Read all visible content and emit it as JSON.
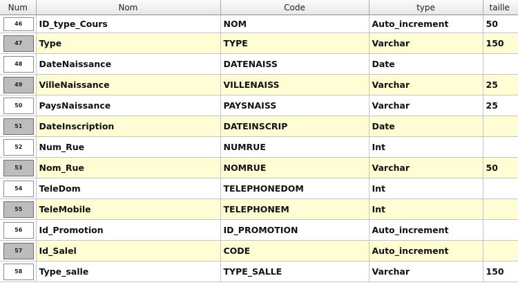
{
  "headers": {
    "num": "Num",
    "nom": "Nom",
    "code": "Code",
    "type": "type",
    "taille": "taille"
  },
  "rows": [
    {
      "num": "46",
      "nom": "ID_type_Cours",
      "code": "NOM",
      "type": "Auto_increment",
      "taille": "50"
    },
    {
      "num": "47",
      "nom": "Type",
      "code": "TYPE",
      "type": "Varchar",
      "taille": "150"
    },
    {
      "num": "48",
      "nom": "DateNaissance",
      "code": "DATENAISS",
      "type": "Date",
      "taille": ""
    },
    {
      "num": "49",
      "nom": "VilleNaissance",
      "code": "VILLENAISS",
      "type": "Varchar",
      "taille": "25"
    },
    {
      "num": "50",
      "nom": "PaysNaissance",
      "code": "PAYSNAISS",
      "type": "Varchar",
      "taille": "25"
    },
    {
      "num": "51",
      "nom": "DateInscription",
      "code": "DATEINSCRIP",
      "type": "Date",
      "taille": ""
    },
    {
      "num": "52",
      "nom": "Num_Rue",
      "code": "NUMRUE",
      "type": "Int",
      "taille": ""
    },
    {
      "num": "53",
      "nom": "Nom_Rue",
      "code": "NOMRUE",
      "type": "Varchar",
      "taille": "50"
    },
    {
      "num": "54",
      "nom": "TeleDom",
      "code": "TELEPHONEDOM",
      "type": "Int",
      "taille": ""
    },
    {
      "num": "55",
      "nom": "TeleMobile",
      "code": "TELEPHONEM",
      "type": "Int",
      "taille": ""
    },
    {
      "num": "56",
      "nom": "Id_Promotion",
      "code": "ID_PROMOTION",
      "type": "Auto_increment",
      "taille": ""
    },
    {
      "num": "57",
      "nom": "Id_Salel",
      "code": "CODE",
      "type": "Auto_increment",
      "taille": ""
    },
    {
      "num": "58",
      "nom": "Type_salle",
      "code": "TYPE_SALLE",
      "type": "Varchar",
      "taille": "150"
    }
  ],
  "colors": {
    "row_alt_background": "#fefdd4",
    "row_background": "#ffffff",
    "num_alt_background": "#bdbdbd",
    "grid_line": "#c4c4c4"
  }
}
